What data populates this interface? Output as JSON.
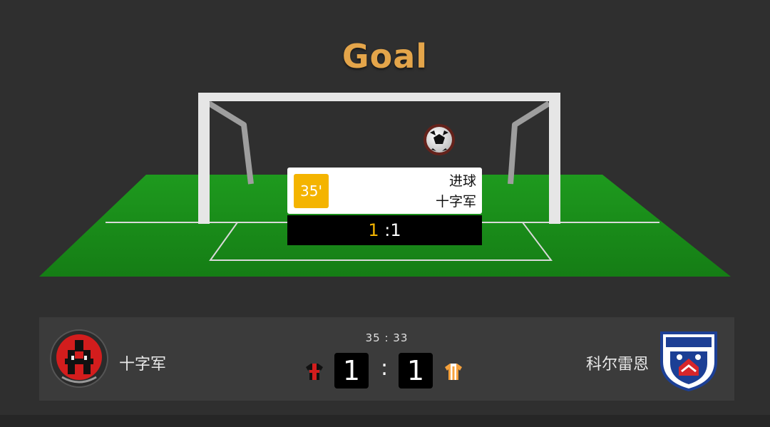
{
  "banner": {
    "title": "Goal"
  },
  "event": {
    "minute": "35'",
    "type": "进球",
    "team": "十字军",
    "score_home": "1",
    "score_sep": ":",
    "score_away": "1"
  },
  "match": {
    "clock": "35 : 33",
    "home": {
      "name": "十字军",
      "score": "1",
      "kit_colors": [
        "#d31d1d",
        "#111111"
      ]
    },
    "away": {
      "name": "科尔雷恩",
      "score": "1",
      "kit_colors": [
        "#f5a13c",
        "#ffffff"
      ]
    },
    "separator": ":"
  },
  "colors": {
    "accent": "#f4b400",
    "pitch": "#1f8a1f",
    "background": "#2f2f2f"
  }
}
